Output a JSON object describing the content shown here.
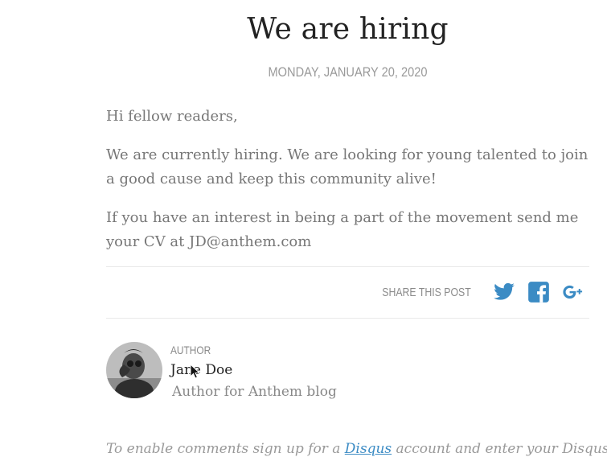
{
  "post": {
    "title": "We are hiring",
    "date": "MONDAY, JANUARY 20, 2020",
    "paragraphs": [
      "Hi fellow readers,",
      "We are currently hiring. We are looking for young talented to join a good cause and keep this community alive!",
      "If you have an interest in being a part of the movement send me your CV at JD@anthem.com"
    ]
  },
  "share": {
    "label": "SHARE THIS POST",
    "icons": [
      "twitter-icon",
      "facebook-icon",
      "google-plus-icon"
    ],
    "color": "#3b8bc4"
  },
  "author": {
    "label": "AUTHOR",
    "name": "Jane Doe",
    "bio": "Author for Anthem blog"
  },
  "comments": {
    "prefix": "To enable comments sign up for a ",
    "link": "Disqus",
    "suffix": " account and enter your Disqus"
  }
}
